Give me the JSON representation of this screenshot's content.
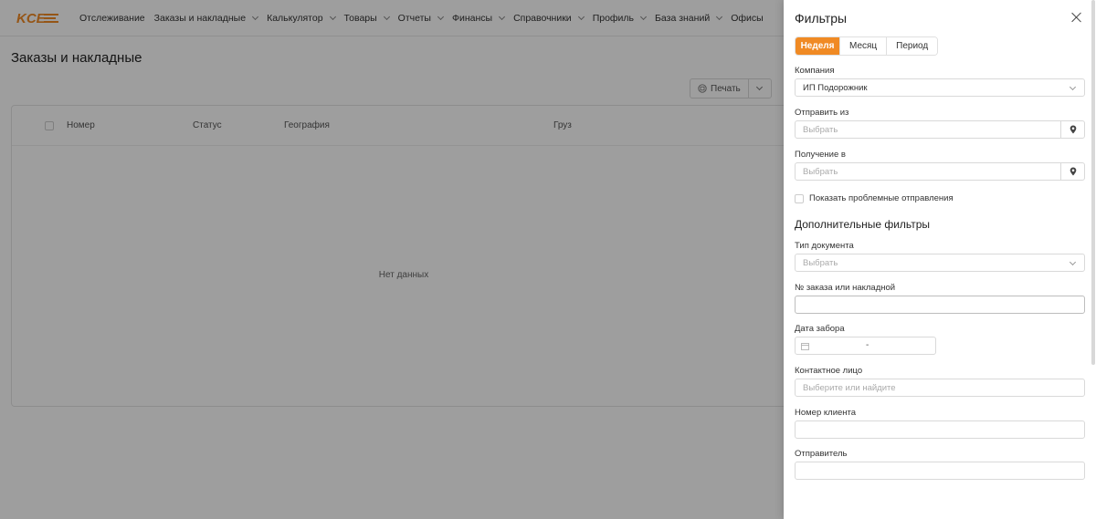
{
  "brand": {
    "logo_text": "KCE",
    "accent": "#f08a24"
  },
  "nav": [
    {
      "label": "Отслеживание",
      "has_dropdown": false
    },
    {
      "label": "Заказы и накладные",
      "has_dropdown": true
    },
    {
      "label": "Калькулятор",
      "has_dropdown": true
    },
    {
      "label": "Товары",
      "has_dropdown": true
    },
    {
      "label": "Отчеты",
      "has_dropdown": true
    },
    {
      "label": "Финансы",
      "has_dropdown": true
    },
    {
      "label": "Справочники",
      "has_dropdown": true
    },
    {
      "label": "Профиль",
      "has_dropdown": true
    },
    {
      "label": "База знаний",
      "has_dropdown": true
    },
    {
      "label": "Офисы",
      "has_dropdown": false
    }
  ],
  "page": {
    "title": "Заказы и накладные",
    "print_label": "Печать",
    "table": {
      "columns": [
        "Номер",
        "Статус",
        "География",
        "Груз"
      ],
      "empty_text": "Нет данных"
    }
  },
  "drawer": {
    "title": "Фильтры",
    "period_tabs": [
      {
        "label": "Неделя",
        "active": true
      },
      {
        "label": "Месяц",
        "active": false
      },
      {
        "label": "Период",
        "active": false
      }
    ],
    "company": {
      "label": "Компания",
      "value": "ИП Подорожник"
    },
    "send_from": {
      "label": "Отправить из",
      "placeholder": "Выбрать"
    },
    "receive_in": {
      "label": "Получение в",
      "placeholder": "Выбрать"
    },
    "problem_checkbox": {
      "label": "Показать проблемные отправления",
      "checked": false
    },
    "extra_title": "Дополнительные фильтры",
    "doc_type": {
      "label": "Тип документа",
      "placeholder": "Выбрать"
    },
    "order_no": {
      "label": "№ заказа или накладной",
      "value": ""
    },
    "pickup_date": {
      "label": "Дата забора",
      "separator": "-"
    },
    "contact": {
      "label": "Контактное лицо",
      "placeholder": "Выберите или найдите"
    },
    "client_no": {
      "label": "Номер клиента",
      "value": ""
    },
    "sender": {
      "label": "Отправитель",
      "value": ""
    }
  }
}
